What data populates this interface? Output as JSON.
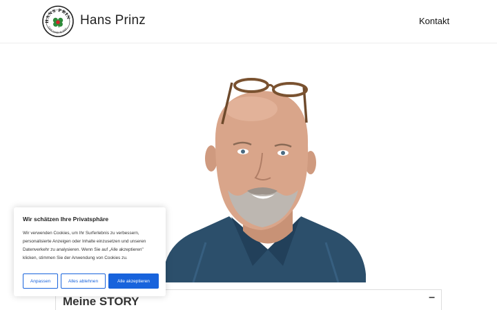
{
  "header": {
    "logo": {
      "top_text": "HANS PRINZ",
      "bottom_text": "Love songs @ your..."
    },
    "site_title": "Hans Prinz",
    "nav": [
      {
        "label": "Kontakt"
      }
    ]
  },
  "accordion": {
    "title": "Meine STORY",
    "toggle": "–"
  },
  "cookie_banner": {
    "title": "Wir schätzen Ihre Privatsphäre",
    "text": "Wir verwenden Cookies, um Ihr Surferlebnis zu verbessern, personalisierte Anzeigen oder Inhalte einzusetzen und unseren Datenverkehr zu analysieren. Wenn Sie auf „Alle akzeptieren\" klicken, stimmen Sie der Anwendung von Cookies zu.",
    "buttons": {
      "customize": "Anpassen",
      "reject": "Alles ablehnen",
      "accept": "Alle akzeptieren"
    }
  },
  "colors": {
    "accent": "#1863dc",
    "border": "#dddddd",
    "shirt": "#2c4f6b",
    "skin": "#d9a58a"
  }
}
